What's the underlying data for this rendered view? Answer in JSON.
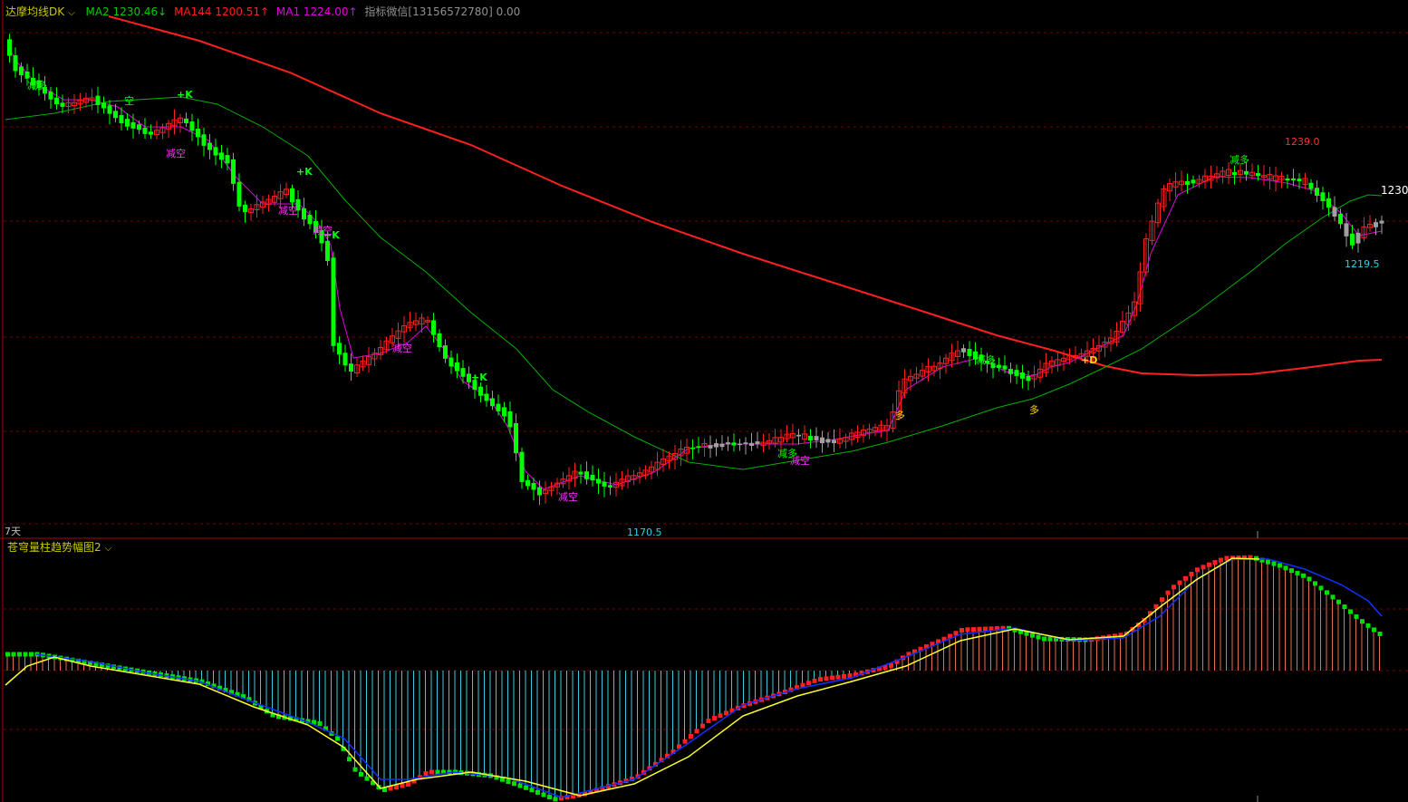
{
  "top_panel": {
    "indicator_name": "达摩均线DK",
    "dropdown_icon": "chevron-down-icon",
    "ma2_label": "MA2 1230.46↓",
    "ma144_label": "MA144 1200.51↑",
    "ma1_label": "MA1 1224.00↑",
    "wechat_label": "指标微信[13156572780] 0.00",
    "period_label": "7天",
    "colors": {
      "ma2": "#00cc00",
      "ma144": "#ff2020",
      "ma1": "#e000e0",
      "text_gray": "#a0a0a0"
    }
  },
  "price_labels": {
    "high": "1239.0",
    "low": "1170.5",
    "last_low": "1219.5",
    "current": "1230"
  },
  "signals": {
    "reduce_long": "减多",
    "reduce_short": "减空",
    "short": "空",
    "long": "多",
    "plus_k": "+K",
    "plus_d": "+D"
  },
  "bottom_panel": {
    "indicator_name": "苍穹量柱趋势幅图2",
    "dropdown_icon": "chevron-down-icon"
  },
  "chart_data": {
    "type": "candlestick",
    "price_min": 1170.5,
    "price_max": 1239.0,
    "last_price": 1230,
    "colors": {
      "up": "#ff2020",
      "down": "#00ff00",
      "flat": "#a0a0a0"
    }
  }
}
